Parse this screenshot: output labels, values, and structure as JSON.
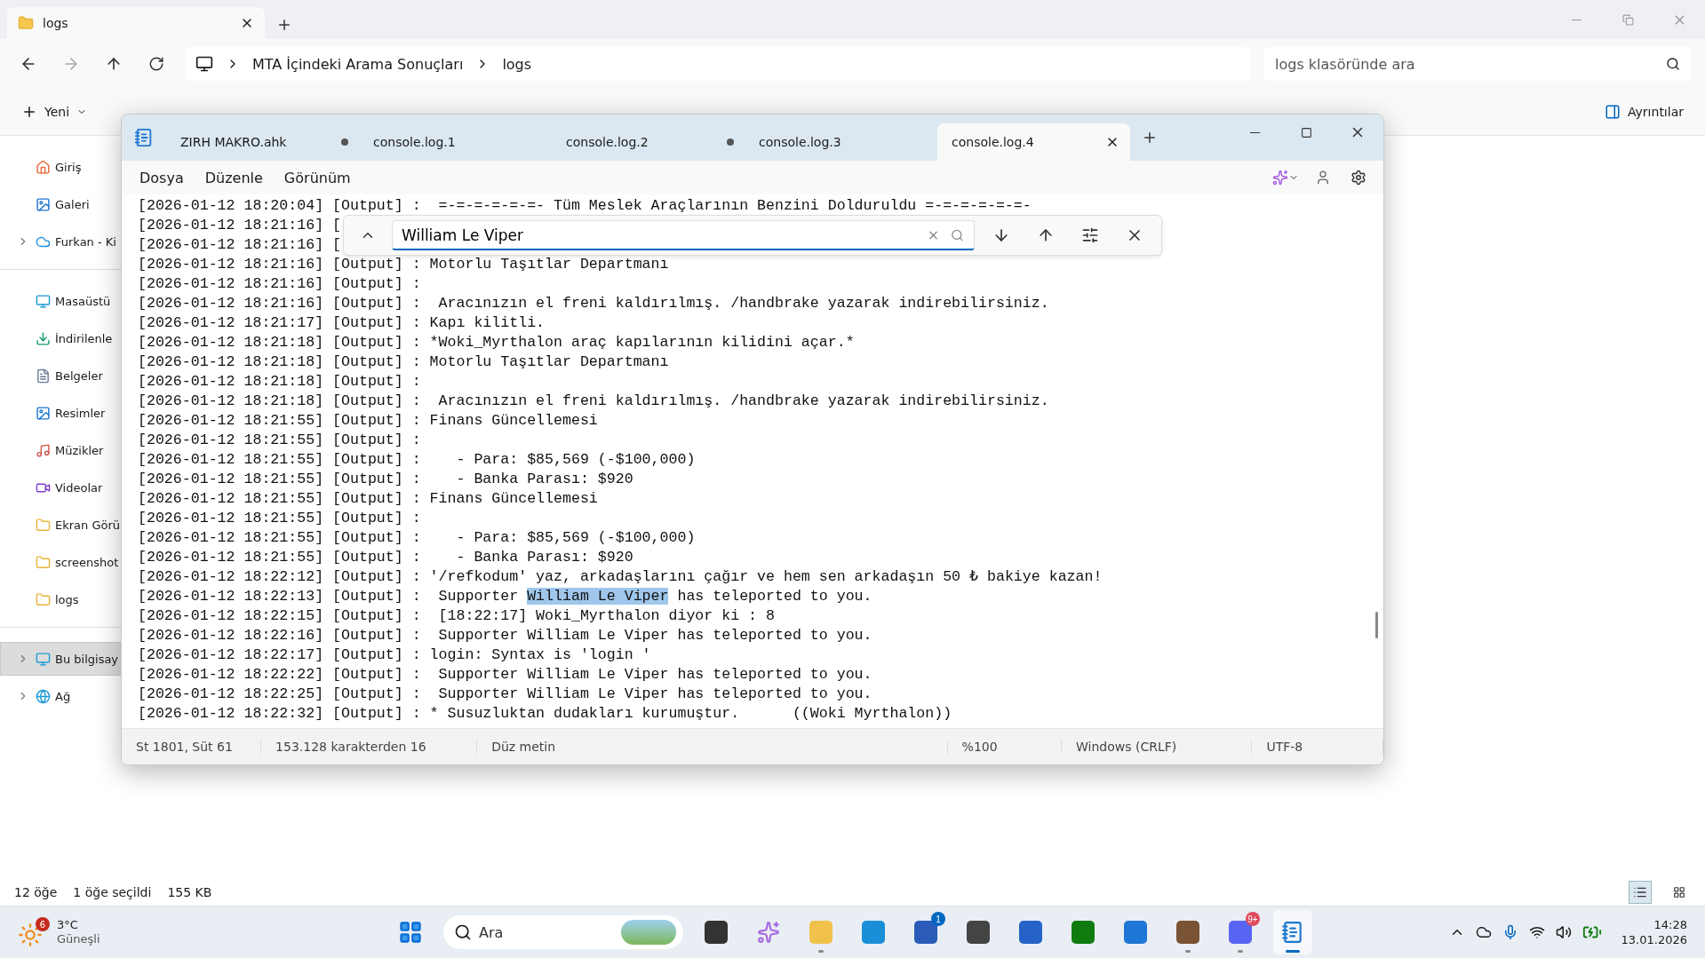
{
  "explorer": {
    "tab": {
      "title": "logs"
    },
    "breadcrumb": [
      "MTA İçindeki Arama Sonuçları",
      "logs"
    ],
    "search": {
      "placeholder": "logs klasöründe ara"
    },
    "new_button": "Yeni",
    "details_button": "Ayrıntılar",
    "sidebar": [
      [
        {
          "label": "Giriş",
          "expandable": false,
          "selected": false
        },
        {
          "label": "Galeri",
          "expandable": false,
          "selected": false
        },
        {
          "label": "Furkan - Ki",
          "expandable": true,
          "selected": false
        }
      ],
      [
        {
          "label": "Masaüstü",
          "expandable": false,
          "selected": false
        },
        {
          "label": "İndirilenle",
          "expandable": false,
          "selected": false
        },
        {
          "label": "Belgeler",
          "expandable": false,
          "selected": false
        },
        {
          "label": "Resimler",
          "expandable": false,
          "selected": false
        },
        {
          "label": "Müzikler",
          "expandable": false,
          "selected": false
        },
        {
          "label": "Videolar",
          "expandable": false,
          "selected": false
        },
        {
          "label": "Ekran Görü",
          "expandable": false,
          "selected": false
        },
        {
          "label": "screenshot",
          "expandable": false,
          "selected": false
        },
        {
          "label": "logs",
          "expandable": false,
          "selected": false
        }
      ],
      [
        {
          "label": "Bu bilgisay",
          "expandable": true,
          "selected": true
        },
        {
          "label": "Ağ",
          "expandable": true,
          "selected": false
        }
      ]
    ],
    "status_bar": [
      "12 öğe",
      "1 öğe seçildi",
      "155 KB"
    ]
  },
  "notepad": {
    "tabs": [
      {
        "title": "ZIRH MAKRO.ahk",
        "modified": true,
        "selected": false
      },
      {
        "title": "console.log.1",
        "modified": false,
        "selected": false
      },
      {
        "title": "console.log.2",
        "modified": true,
        "selected": false
      },
      {
        "title": "console.log.3",
        "modified": false,
        "selected": false
      },
      {
        "title": "console.log.4",
        "modified": false,
        "selected": true
      }
    ],
    "menu": [
      "Dosya",
      "Düzenle",
      "Görünüm"
    ],
    "find": {
      "value": "William Le Viper"
    },
    "lines": [
      {
        "text": "[2026-01-12 18:20:04] [Output] :  =-=-=-=-=-=- Tüm Meslek Araçlarının Benzini Dolduruldu =-=-=-=-=-=-"
      },
      {
        "text": "[2026-01-12 18:21:16] ["
      },
      {
        "text": "[2026-01-12 18:21:16] ["
      },
      {
        "text": "[2026-01-12 18:21:16] [Output] : Motorlu Taşıtlar Departmanı"
      },
      {
        "text": "[2026-01-12 18:21:16] [Output] :"
      },
      {
        "text": "[2026-01-12 18:21:16] [Output] :  Aracınızın el freni kaldırılmış. /handbrake yazarak indirebilirsiniz."
      },
      {
        "text": "[2026-01-12 18:21:17] [Output] : Kapı kilitli."
      },
      {
        "text": "[2026-01-12 18:21:18] [Output] : *Woki_Myrthalon araç kapılarının kilidini açar.*"
      },
      {
        "text": "[2026-01-12 18:21:18] [Output] : Motorlu Taşıtlar Departmanı"
      },
      {
        "text": "[2026-01-12 18:21:18] [Output] :"
      },
      {
        "text": "[2026-01-12 18:21:18] [Output] :  Aracınızın el freni kaldırılmış. /handbrake yazarak indirebilirsiniz."
      },
      {
        "text": "[2026-01-12 18:21:55] [Output] : Finans Güncellemesi"
      },
      {
        "text": "[2026-01-12 18:21:55] [Output] :"
      },
      {
        "text": "[2026-01-12 18:21:55] [Output] :    - Para: $85,569 (-$100,000)"
      },
      {
        "text": "[2026-01-12 18:21:55] [Output] :    - Banka Parası: $920"
      },
      {
        "text": "[2026-01-12 18:21:55] [Output] : Finans Güncellemesi"
      },
      {
        "text": "[2026-01-12 18:21:55] [Output] :"
      },
      {
        "text": "[2026-01-12 18:21:55] [Output] :    - Para: $85,569 (-$100,000)"
      },
      {
        "text": "[2026-01-12 18:21:55] [Output] :    - Banka Parası: $920"
      },
      {
        "text": "[2026-01-12 18:22:12] [Output] : '/refkodum' yaz, arkadaşlarını çağır ve hem sen arkadaşın 50 ₺ bakiye kazan!"
      },
      {
        "text": "[2026-01-12 18:22:13] [Output] :  Supporter ",
        "match": "William Le Viper",
        "rest": " has teleported to you."
      },
      {
        "text": "[2026-01-12 18:22:15] [Output] :  [18:22:17] Woki_Myrthalon diyor ki : 8"
      },
      {
        "text": "[2026-01-12 18:22:16] [Output] :  Supporter William Le Viper has teleported to you."
      },
      {
        "text": "[2026-01-12 18:22:17] [Output] : login: Syntax is 'login '"
      },
      {
        "text": "[2026-01-12 18:22:22] [Output] :  Supporter William Le Viper has teleported to you."
      },
      {
        "text": "[2026-01-12 18:22:25] [Output] :  Supporter William Le Viper has teleported to you."
      },
      {
        "text": "[2026-01-12 18:22:32] [Output] : * Susuzluktan dudakları kurumuştur.      ((Woki Myrthalon))"
      }
    ],
    "status_bar": [
      "St 1801, Süt 61",
      "153.128 karakterden 16",
      "Düz metin",
      "%100",
      "Windows (CRLF)",
      "UTF-8"
    ]
  },
  "taskbar": {
    "weather": {
      "badge": "6",
      "temp": "3°C",
      "condition": "Güneşli"
    },
    "search": {
      "placeholder": "Ara"
    },
    "apps": [
      {
        "running": false,
        "active": false
      },
      {
        "running": false,
        "active": false
      },
      {
        "running": true,
        "active": false
      },
      {
        "running": false,
        "active": false
      },
      {
        "running": false,
        "active": false,
        "badge": "1"
      },
      {
        "running": false,
        "active": false
      },
      {
        "running": false,
        "active": false
      },
      {
        "running": false,
        "active": false
      },
      {
        "running": false,
        "active": false
      },
      {
        "running": true,
        "active": false
      },
      {
        "running": true,
        "active": false,
        "badge": "9+"
      },
      {
        "running": true,
        "active": true
      }
    ],
    "time": "14:28",
    "date": "13.01.2026"
  }
}
